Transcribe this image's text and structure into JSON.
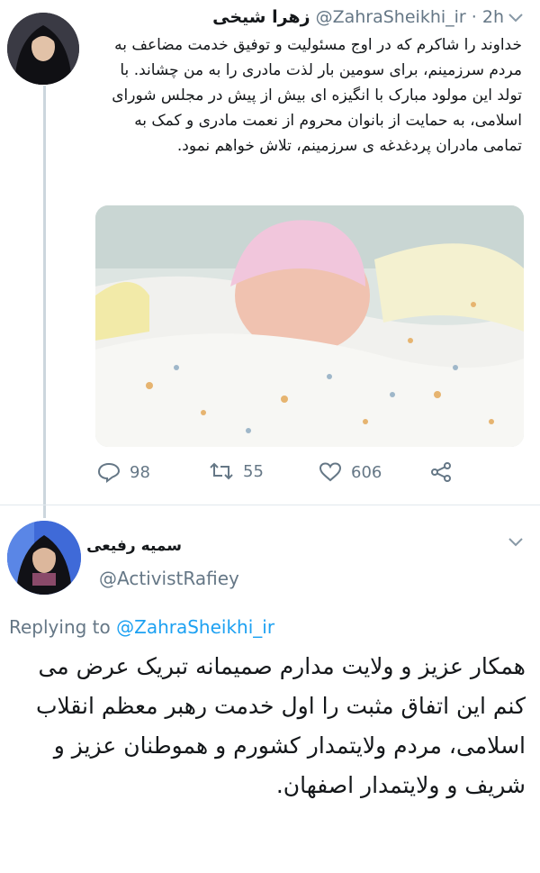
{
  "tweet": {
    "author_name": "زهرا شیخی",
    "handle": "@ZahraSheikhi_ir",
    "time": "· 2h",
    "text": "خداوند را شاکرم که در اوج مسئولیت و توفیق خدمت مضاعف به مردم سرزمینم، برای سومین بار لذت مادری را به من چشاند. با تولد این مولود مبارک با انگیزه ای بیش از پیش در مجلس شورای اسلامی، به حمایت از بانوان محروم از نعمت مادری و کمک به تمامی مادران پردغدغه ی سرزمینم، تلاش خواهم نمود.",
    "reply_count": "98",
    "retweet_count": "55",
    "like_count": "606"
  },
  "reply": {
    "author_name": "سمیه رفیعی",
    "handle": "@ActivistRafiey",
    "replying_label": "Replying to",
    "replying_to": "@ZahraSheikhi_ir",
    "text": "همکار عزیز و ولایت مدارم صمیمانه تبریک عرض می کنم این اتفاق مثبت را اول خدمت رهبر معظم انقلاب اسلامی، مردم ولایتمدار کشورم و هموطنان عزیز و شریف و ولایتمدار اصفهان."
  },
  "colors": {
    "text": "#14171a",
    "secondary": "#657786",
    "link": "#1da1f2",
    "thread_line": "#ccd6dd"
  },
  "icons": [
    "chevron-down-icon",
    "reply-icon",
    "retweet-icon",
    "like-icon",
    "share-icon"
  ]
}
